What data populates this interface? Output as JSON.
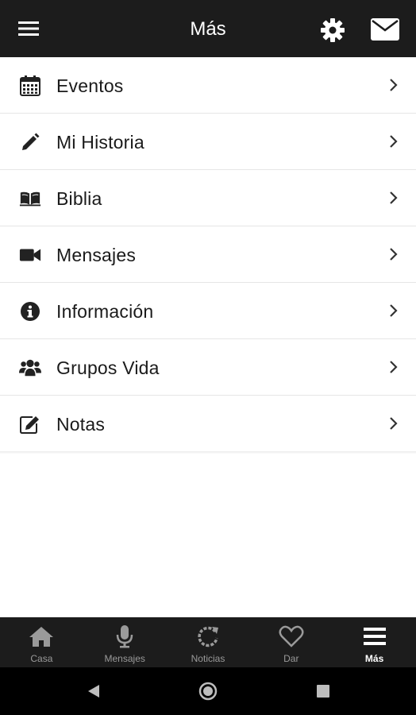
{
  "header": {
    "title": "Más",
    "menu_icon": "hamburger-menu-icon",
    "settings_icon": "gear-icon",
    "mail_icon": "envelope-icon"
  },
  "menu": {
    "items": [
      {
        "label": "Eventos",
        "icon": "calendar-icon"
      },
      {
        "label": "Mi Historia",
        "icon": "pencil-icon"
      },
      {
        "label": "Biblia",
        "icon": "book-icon"
      },
      {
        "label": "Mensajes",
        "icon": "video-camera-icon"
      },
      {
        "label": "Información",
        "icon": "info-icon"
      },
      {
        "label": "Grupos Vida",
        "icon": "users-group-icon"
      },
      {
        "label": "Notas",
        "icon": "edit-note-icon"
      }
    ]
  },
  "bottom_nav": {
    "items": [
      {
        "label": "Casa",
        "icon": "home-icon"
      },
      {
        "label": "Mensajes",
        "icon": "microphone-icon"
      },
      {
        "label": "Noticias",
        "icon": "refresh-icon"
      },
      {
        "label": "Dar",
        "icon": "heart-icon"
      },
      {
        "label": "Más",
        "icon": "menu-lines-icon",
        "active": true
      }
    ]
  },
  "colors": {
    "bar_background": "#1c1c1c",
    "inactive_nav": "#9a9a9a",
    "active_nav": "#ffffff",
    "text": "#1a1a1a"
  }
}
